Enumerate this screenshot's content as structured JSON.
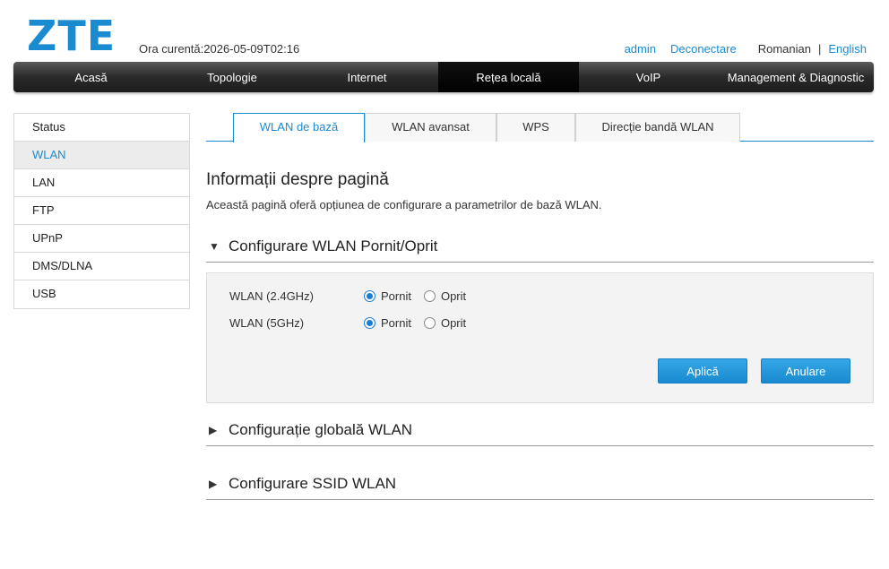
{
  "header": {
    "logo": "ZTE",
    "current_time": "Ora curentă:2026-05-09T02:16",
    "user": "admin",
    "logout": "Deconectare",
    "lang_current": "Romanian",
    "lang_separator": "|",
    "lang_other": "English"
  },
  "nav": {
    "items": [
      "Acasă",
      "Topologie",
      "Internet",
      "Rețea locală",
      "VoIP",
      "Management & Diagnostic"
    ],
    "active": "Rețea locală"
  },
  "sidebar": {
    "items": [
      "Status",
      "WLAN",
      "LAN",
      "FTP",
      "UPnP",
      "DMS/DLNA",
      "USB"
    ],
    "active": "WLAN"
  },
  "tabs": {
    "items": [
      "WLAN de bază",
      "WLAN avansat",
      "WPS",
      "Direcție bandă WLAN"
    ],
    "active": "WLAN de bază"
  },
  "page": {
    "title": "Informații despre pagină",
    "description": "Această pagină oferă opțiunea de configurare a parametrilor de bază WLAN."
  },
  "sections": {
    "onoff": {
      "title": "Configurare WLAN Pornit/Oprit",
      "expanded": true,
      "arrow": "▼"
    },
    "global": {
      "title": "Configurație globală WLAN",
      "expanded": false,
      "arrow": "▶"
    },
    "ssid": {
      "title": "Configurare SSID WLAN",
      "expanded": false,
      "arrow": "▶"
    }
  },
  "wlan_onoff": {
    "rows": [
      {
        "label": "WLAN (2.4GHz)",
        "on_label": "Pornit",
        "off_label": "Oprit",
        "value": "Pornit"
      },
      {
        "label": "WLAN (5GHz)",
        "on_label": "Pornit",
        "off_label": "Oprit",
        "value": "Pornit"
      }
    ],
    "apply_label": "Aplică",
    "cancel_label": "Anulare"
  },
  "colors": {
    "accent": "#1a8bd1",
    "nav_bg": "#2a2a2a",
    "panel_bg": "#f3f3f3"
  }
}
